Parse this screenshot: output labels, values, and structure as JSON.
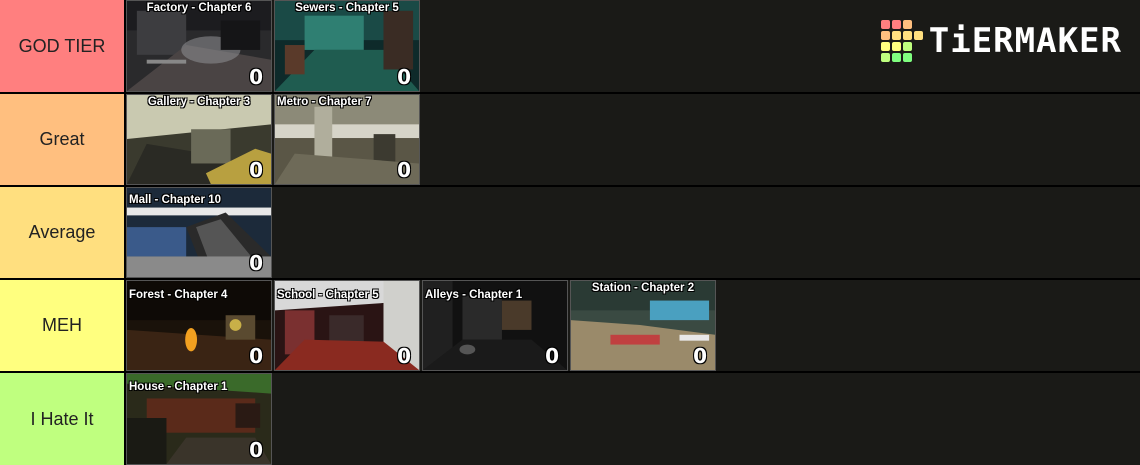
{
  "tiers": [
    {
      "label": "GOD TIER",
      "color": "#ff7f7f",
      "items": [
        {
          "title": "Factory - Chapter 6",
          "count": "0",
          "scene": "factory"
        },
        {
          "title": "Sewers - Chapter 5",
          "count": "0",
          "scene": "sewers"
        }
      ]
    },
    {
      "label": "Great",
      "color": "#ffbf7f",
      "items": [
        {
          "title": "Gallery - Chapter 3",
          "count": "0",
          "scene": "gallery"
        },
        {
          "title": "Metro - Chapter 7",
          "count": "0",
          "scene": "metro"
        }
      ]
    },
    {
      "label": "Average",
      "color": "#ffdf7f",
      "items": [
        {
          "title": "Mall - Chapter 10",
          "count": "0",
          "scene": "mall"
        }
      ]
    },
    {
      "label": "MEH",
      "color": "#ffff7f",
      "items": [
        {
          "title": "Forest - Chapter 4",
          "count": "0",
          "scene": "forest"
        },
        {
          "title": "School - Chapter 5",
          "count": "0",
          "scene": "school"
        },
        {
          "title": "Alleys - Chapter 1",
          "count": "0",
          "scene": "alleys"
        },
        {
          "title": "Station - Chapter 2",
          "count": "0",
          "scene": "station"
        }
      ]
    },
    {
      "label": "I Hate It",
      "color": "#bfff7f",
      "items": [
        {
          "title": "House - Chapter 1",
          "count": "0",
          "scene": "house"
        }
      ]
    }
  ],
  "logo": {
    "text": "TiERMAKER",
    "grid_colors": [
      "#ff7f7f",
      "#ff7f7f",
      "#ffbf7f",
      "#1a1a17",
      "#ffbf7f",
      "#ffdf7f",
      "#ffdf7f",
      "#ffdf7f",
      "#ffff7f",
      "#ffff7f",
      "#bfff7f",
      "#1a1a17",
      "#bfff7f",
      "#7fff7f",
      "#7fff7f",
      "#1a1a17"
    ]
  }
}
